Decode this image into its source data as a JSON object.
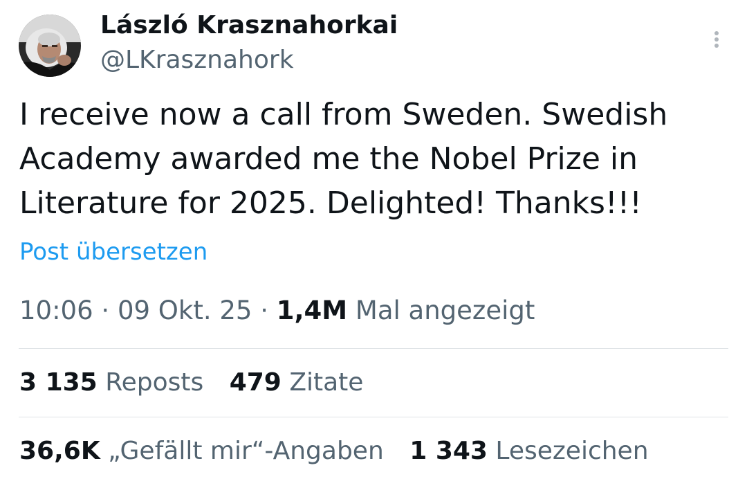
{
  "author": {
    "display_name": "László Krasznahorkai",
    "handle": "@LKrasznahork"
  },
  "tweet": {
    "lines": [
      "I receive now a call from Sweden. Swedish",
      "Academy awarded me the Nobel Prize in",
      "Literature for 2025. Delighted! Thanks!!!"
    ],
    "translate_label": "Post übersetzen"
  },
  "meta": {
    "time": "10:06",
    "separator": "·",
    "date": "09 Okt. 25",
    "views_count": "1,4M",
    "views_label": "Mal angezeigt"
  },
  "stats": {
    "reposts": {
      "count": "3 135",
      "label": "Reposts"
    },
    "quotes": {
      "count": "479",
      "label": "Zitate"
    },
    "likes": {
      "count": "36,6K",
      "label": "„Gefällt mir“-Angaben"
    },
    "bookmarks": {
      "count": "1 343",
      "label": "Lesezeichen"
    }
  },
  "icons": {
    "more": "more-vertical-icon"
  },
  "colors": {
    "text_primary": "#0f1419",
    "text_secondary": "#536471",
    "link": "#1d9bf0",
    "divider": "#dfe3e6"
  }
}
